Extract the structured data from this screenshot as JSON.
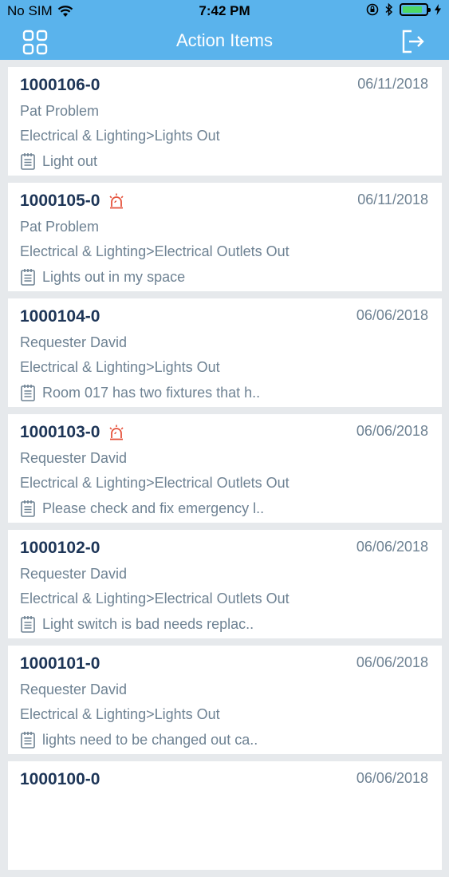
{
  "status_bar": {
    "carrier": "No SIM",
    "time": "7:42 PM",
    "battery_percent": 85,
    "battery_color": "#4cd964"
  },
  "header": {
    "title": "Action Items",
    "left_icon": "grid-menu-icon",
    "right_icon": "logout-icon",
    "background": "#5ab3ec"
  },
  "items": [
    {
      "id": "1000106-0",
      "urgent": false,
      "date": "06/11/2018",
      "requester": "Pat Problem",
      "category": "Electrical & Lighting>Lights Out",
      "description": "Light out"
    },
    {
      "id": "1000105-0",
      "urgent": true,
      "date": "06/11/2018",
      "requester": "Pat Problem",
      "category": "Electrical & Lighting>Electrical Outlets Out",
      "description": "Lights out in my space"
    },
    {
      "id": "1000104-0",
      "urgent": false,
      "date": "06/06/2018",
      "requester": "Requester David",
      "category": "Electrical & Lighting>Lights Out",
      "description": "Room 017 has two fixtures that h.."
    },
    {
      "id": "1000103-0",
      "urgent": true,
      "date": "06/06/2018",
      "requester": "Requester David",
      "category": "Electrical & Lighting>Electrical Outlets Out",
      "description": "Please check and fix emergency l.."
    },
    {
      "id": "1000102-0",
      "urgent": false,
      "date": "06/06/2018",
      "requester": "Requester David",
      "category": "Electrical & Lighting>Electrical Outlets Out",
      "description": "Light switch is bad needs replac.."
    },
    {
      "id": "1000101-0",
      "urgent": false,
      "date": "06/06/2018",
      "requester": "Requester David",
      "category": "Electrical & Lighting>Lights Out",
      "description": "lights need to be changed out ca.."
    },
    {
      "id": "1000100-0",
      "urgent": false,
      "date": "06/06/2018",
      "requester": "",
      "category": "",
      "description": ""
    }
  ],
  "colors": {
    "id_text": "#1d3557",
    "secondary_text": "#6e8293",
    "alarm": "#e5533d"
  }
}
